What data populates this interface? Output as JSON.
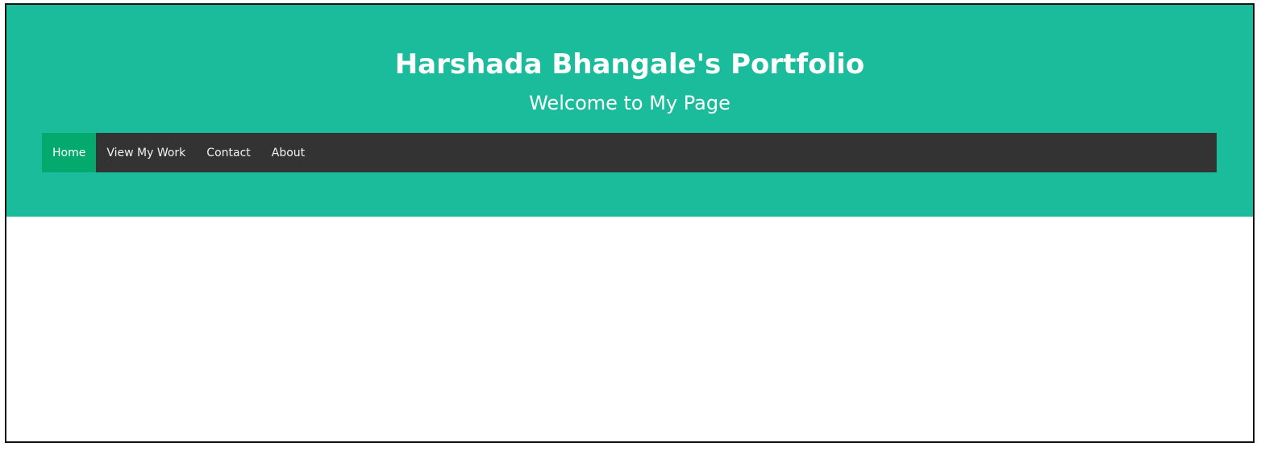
{
  "header": {
    "title": "Harshada Bhangale's Portfolio",
    "subtitle": "Welcome to My Page"
  },
  "nav": {
    "items": [
      {
        "label": "Home",
        "active": true
      },
      {
        "label": "View My Work",
        "active": false
      },
      {
        "label": "Contact",
        "active": false
      },
      {
        "label": "About",
        "active": false
      }
    ]
  },
  "colors": {
    "hero_background": "#1bbc9b",
    "navbar_background": "#333333",
    "active_nav": "#04aa6d",
    "text": "#ffffff"
  }
}
